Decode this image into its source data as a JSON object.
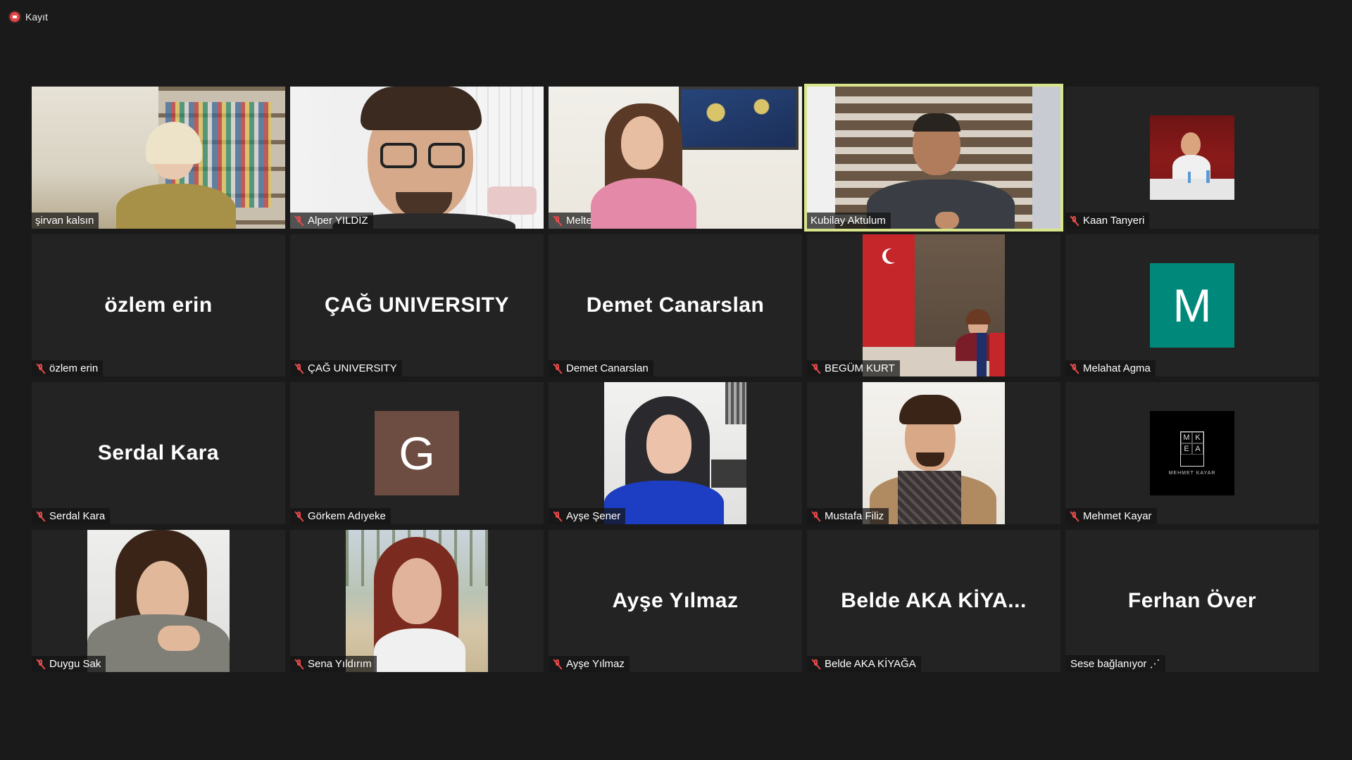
{
  "recording": {
    "label": "Kayıt",
    "color": "#e24848"
  },
  "grid": {
    "tiles": [
      {
        "name": "şirvan kalsın",
        "muted": false,
        "type": "video"
      },
      {
        "name": "Alper YILDIZ",
        "muted": true,
        "type": "video"
      },
      {
        "name": "Meltem Akin",
        "muted": true,
        "type": "video"
      },
      {
        "name": "Kubilay Aktulum",
        "muted": false,
        "type": "video",
        "active_speaker": true
      },
      {
        "name": "Kaan Tanyeri",
        "muted": true,
        "type": "photo"
      },
      {
        "name": "özlem erin",
        "display": "özlem erin",
        "muted": true,
        "type": "name"
      },
      {
        "name": "ÇAĞ UNIVERSITY",
        "display": "ÇAĞ UNIVERSITY",
        "muted": true,
        "type": "name"
      },
      {
        "name": "Demet Canarslan",
        "display": "Demet Canarslan",
        "muted": true,
        "type": "name"
      },
      {
        "name": "BEGÜM KURT",
        "muted": true,
        "type": "photo"
      },
      {
        "name": "Melahat Agma",
        "avatar_letter": "M",
        "avatar_color": "#00897b",
        "muted": true,
        "type": "avatar"
      },
      {
        "name": "Serdal Kara",
        "display": "Serdal Kara",
        "muted": true,
        "type": "name"
      },
      {
        "name": "Görkem Adıyeke",
        "avatar_letter": "G",
        "avatar_color": "#6d4c41",
        "muted": true,
        "type": "avatar"
      },
      {
        "name": "Ayşe Şener",
        "muted": true,
        "type": "photo"
      },
      {
        "name": "Mustafa Filiz",
        "muted": true,
        "type": "photo"
      },
      {
        "name": "Mehmet Kayar",
        "logo_letters": [
          "M",
          "K",
          "E",
          "A"
        ],
        "logo_text": "MEHMET KAYAR",
        "muted": true,
        "type": "logo"
      },
      {
        "name": "Duygu Sak",
        "muted": true,
        "type": "photo"
      },
      {
        "name": "Sena Yıldırım",
        "muted": true,
        "type": "photo"
      },
      {
        "name": "Ayşe Yılmaz",
        "display": "Ayşe Yılmaz",
        "muted": true,
        "type": "name"
      },
      {
        "name": "Belde AKA KİYAĞA",
        "display": "Belde AKA KİYA...",
        "muted": true,
        "type": "name"
      },
      {
        "name": "Ferhan Över",
        "display": "Ferhan Över",
        "status": "Sese bağlanıyor",
        "muted": false,
        "type": "name"
      }
    ]
  },
  "colors": {
    "background": "#1a1a1a",
    "tile": "#232323",
    "active_border": "#d8e58a",
    "muted_icon": "#e84a4a"
  },
  "icons": {
    "muted": "mic-off-icon",
    "recording": "record-icon"
  }
}
